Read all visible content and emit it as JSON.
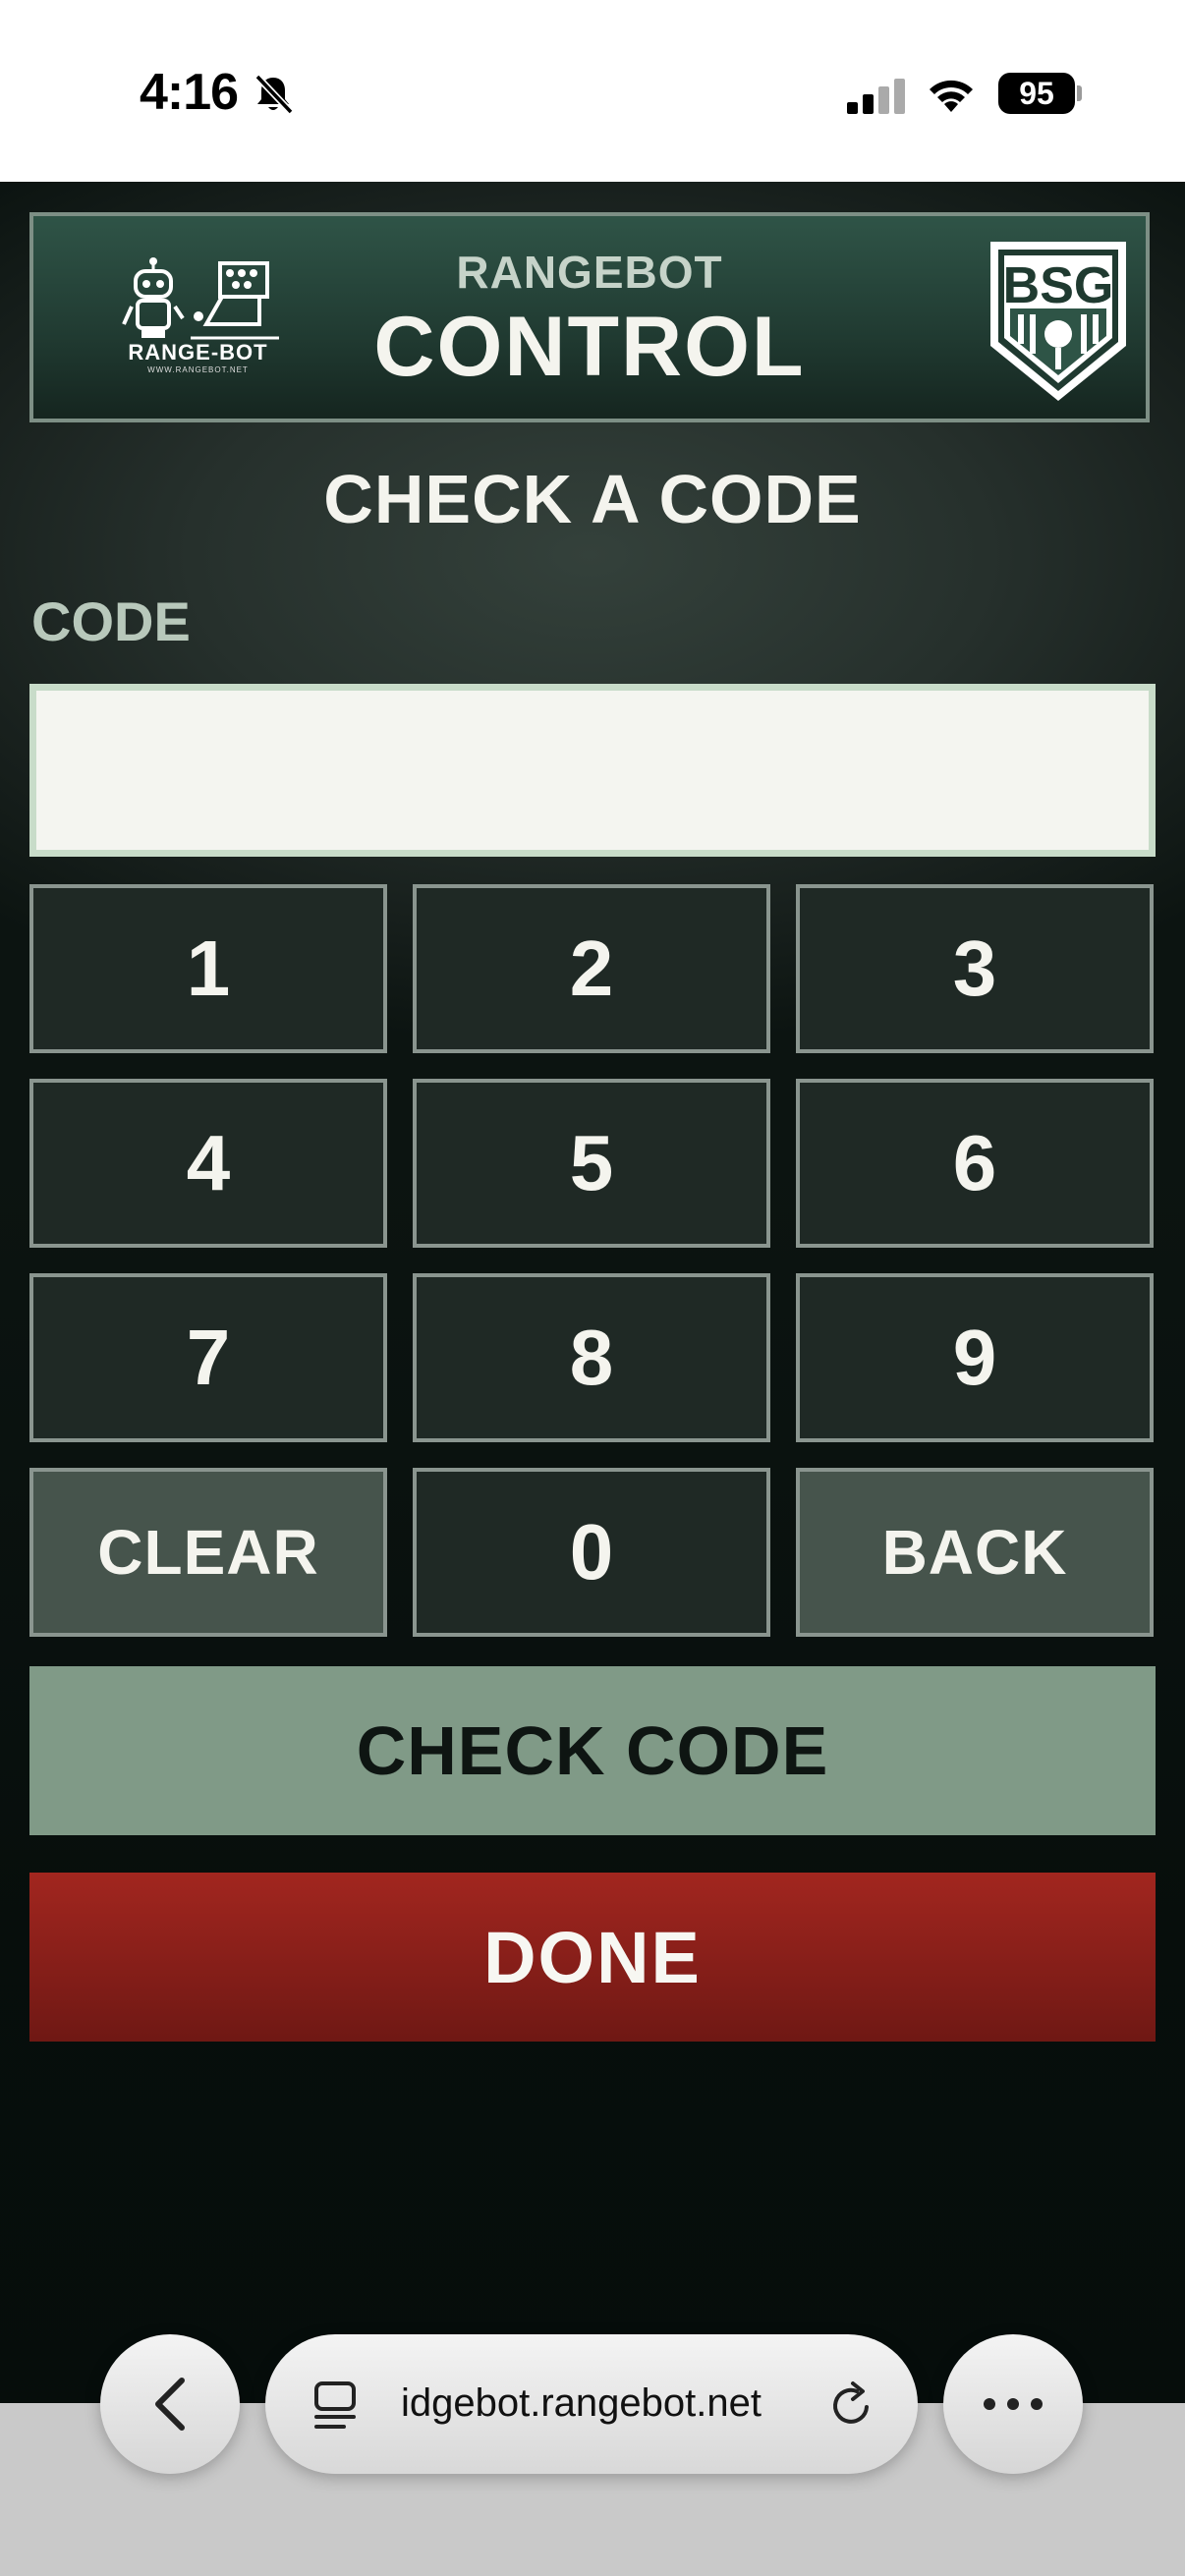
{
  "status_bar": {
    "time": "4:16",
    "battery": "95"
  },
  "header": {
    "left_logo_text": "RANGE-BOT",
    "left_logo_subtext": "WWW.RANGEBOT.NET",
    "subtitle": "RANGEBOT",
    "title": "CONTROL",
    "right_logo_text": "BSG"
  },
  "main": {
    "page_title": "CHECK A CODE",
    "code_label": "CODE",
    "code_value": "",
    "keypad": [
      "1",
      "2",
      "3",
      "4",
      "5",
      "6",
      "7",
      "8",
      "9",
      "CLEAR",
      "0",
      "BACK"
    ],
    "check_button": "CHECK CODE",
    "done_button": "DONE"
  },
  "browser": {
    "url": "idgebot.rangebot.net"
  },
  "colors": {
    "header_green": "#203a31",
    "key_bg": "#1f2925",
    "key_alt_bg": "#46544c",
    "check_button": "#809a87",
    "done_button": "#a2261f"
  }
}
